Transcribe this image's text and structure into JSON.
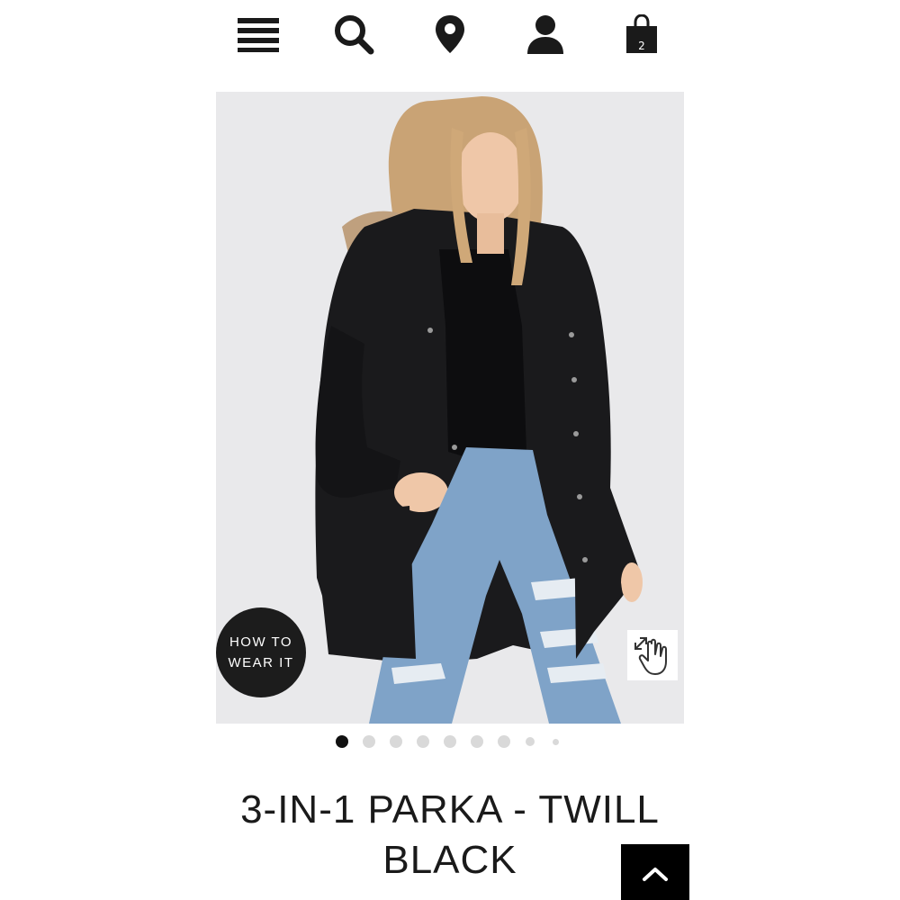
{
  "nav": {
    "icons": [
      "menu-icon",
      "search-icon",
      "location-pin-icon",
      "account-icon",
      "shopping-bag-icon"
    ],
    "cart_count": "2"
  },
  "product": {
    "title_line1": "3-IN-1 PARKA - TWILL",
    "title_line2": "BLACK",
    "how_to_wear_line1": "HOW TO",
    "how_to_wear_line2": "WEAR IT"
  },
  "gallery": {
    "image_count": 9,
    "active_index": 0
  },
  "colors": {
    "primary": "#000000",
    "image_bg": "#e9e9eb",
    "dot_inactive": "#d9d9d9"
  }
}
